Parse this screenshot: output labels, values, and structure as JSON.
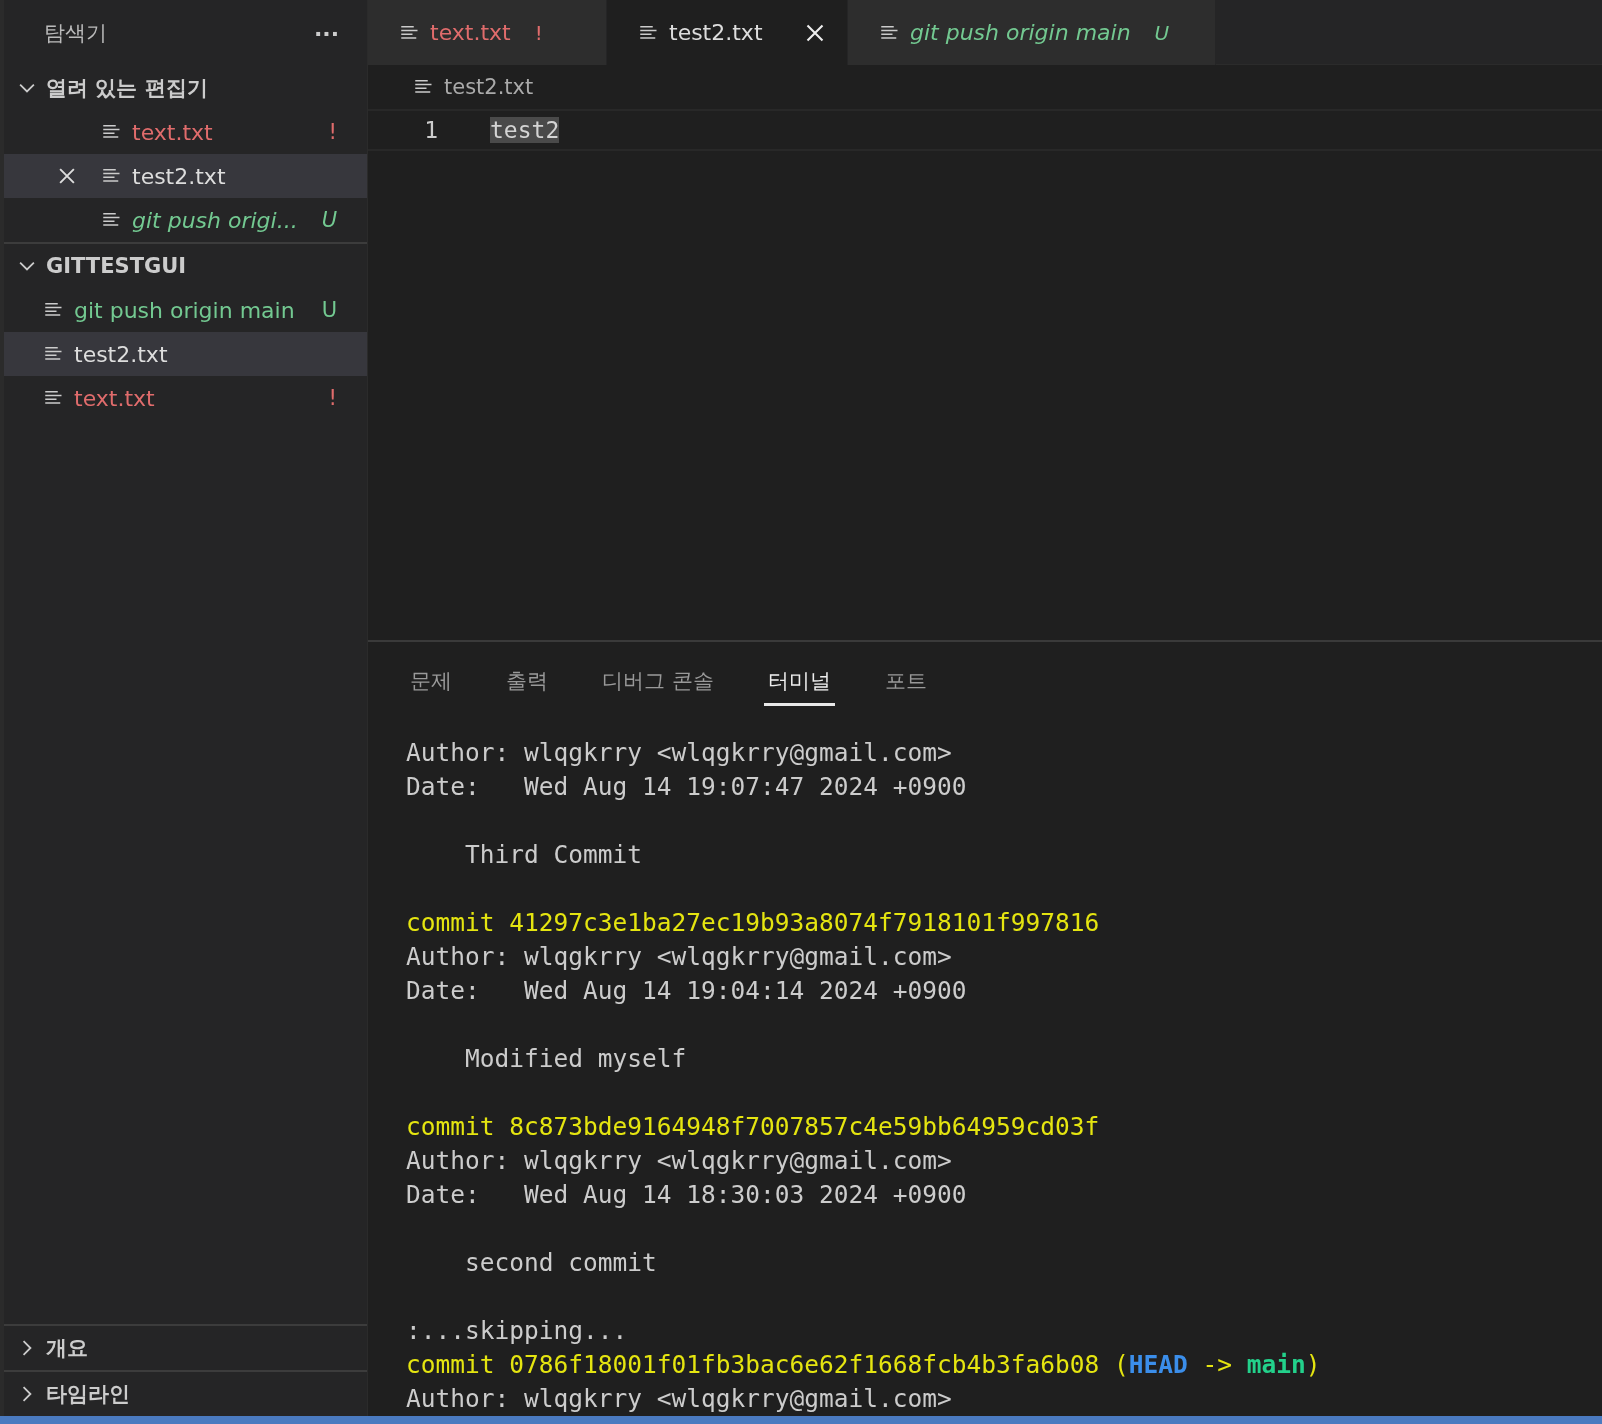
{
  "sidebar": {
    "title": "탐색기",
    "more": "···",
    "sections": [
      {
        "title": "열려 있는 편집기",
        "expanded": true,
        "kind": "open",
        "items": [
          {
            "name": "text.txt",
            "status": "!",
            "kind": "modified",
            "preview": false,
            "selected": false
          },
          {
            "name": "test2.txt",
            "kind": "normal",
            "preview": false,
            "selected": true
          },
          {
            "name": "git push origi...",
            "status": "U",
            "kind": "untracked",
            "preview": true,
            "selected": false
          }
        ]
      },
      {
        "title": "GITTESTGUI",
        "expanded": true,
        "kind": "folder",
        "items": [
          {
            "name": "git push origin main",
            "status": "U",
            "kind": "untracked",
            "preview": false,
            "selected": false
          },
          {
            "name": "test2.txt",
            "kind": "normal",
            "preview": false,
            "selected": true
          },
          {
            "name": "text.txt",
            "status": "!",
            "kind": "modified",
            "preview": false,
            "selected": false
          }
        ]
      }
    ],
    "bottom_sections": [
      {
        "title": "개요",
        "expanded": false
      },
      {
        "title": "타임라인",
        "expanded": false
      }
    ]
  },
  "tabs": [
    {
      "name": "text.txt",
      "status": "!",
      "kind": "modified",
      "preview": false,
      "selected": false
    },
    {
      "name": "test2.txt",
      "kind": "normal",
      "preview": false,
      "selected": true
    },
    {
      "name": "git push origin main",
      "status": "U",
      "kind": "untracked",
      "preview": true,
      "selected": false
    }
  ],
  "breadcrumb": "test2.txt",
  "editor": {
    "lines": [
      {
        "number": "1",
        "text": "test2"
      }
    ]
  },
  "panel": {
    "tabs": [
      {
        "label": "문제",
        "selected": false
      },
      {
        "label": "출력",
        "selected": false
      },
      {
        "label": "디버그 콘솔",
        "selected": false
      },
      {
        "label": "터미널",
        "selected": true
      },
      {
        "label": "포트",
        "selected": false
      }
    ],
    "terminal": [
      {
        "lines": [
          [
            {
              "kind": "plain",
              "text": "Author: wlqgkrry <wlqgkrry@gmail.com>"
            }
          ],
          [
            {
              "kind": "plain",
              "text": "Date:   Wed Aug 14 19:07:47 2024 +0900"
            }
          ]
        ]
      },
      {
        "lines": [
          [
            {
              "kind": "plain",
              "text": "    Third Commit"
            }
          ]
        ]
      },
      {
        "lines": [
          [
            {
              "kind": "hash",
              "text": "commit 41297c3e1ba27ec19b93a8074f7918101f997816"
            }
          ],
          [
            {
              "kind": "plain",
              "text": "Author: wlqgkrry <wlqgkrry@gmail.com>"
            }
          ],
          [
            {
              "kind": "plain",
              "text": "Date:   Wed Aug 14 19:04:14 2024 +0900"
            }
          ]
        ]
      },
      {
        "lines": [
          [
            {
              "kind": "plain",
              "text": "    Modified myself"
            }
          ]
        ]
      },
      {
        "lines": [
          [
            {
              "kind": "hash",
              "text": "commit 8c873bde9164948f7007857c4e59bb64959cd03f"
            }
          ],
          [
            {
              "kind": "plain",
              "text": "Author: wlqgkrry <wlqgkrry@gmail.com>"
            }
          ],
          [
            {
              "kind": "plain",
              "text": "Date:   Wed Aug 14 18:30:03 2024 +0900"
            }
          ]
        ]
      },
      {
        "lines": [
          [
            {
              "kind": "plain",
              "text": "    second commit"
            }
          ]
        ]
      },
      {
        "lines": [
          [
            {
              "kind": "plain",
              "text": ":...skipping..."
            }
          ],
          [
            {
              "kind": "hash",
              "text": "commit 0786f18001f01fb3bac6e62f1668fcb4b3fa6b08 ("
            },
            {
              "kind": "head",
              "text": "HEAD"
            },
            {
              "kind": "hash",
              "text": " -> "
            },
            {
              "kind": "branch",
              "text": "main"
            },
            {
              "kind": "hash",
              "text": ")"
            }
          ],
          [
            {
              "kind": "plain",
              "text": "Author: wlqgkrry <wlqgkrry@gmail.com>"
            }
          ]
        ]
      }
    ]
  }
}
